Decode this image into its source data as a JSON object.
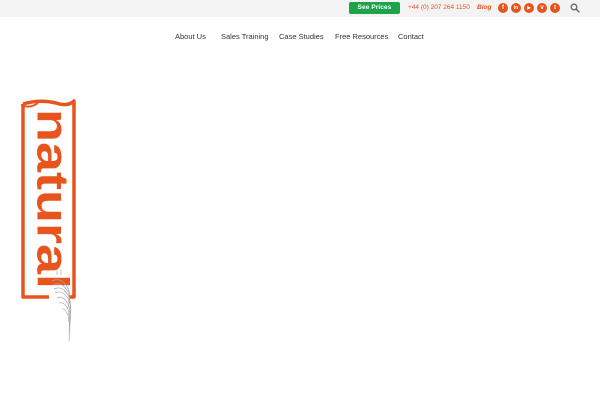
{
  "topbar": {
    "cta_label": "See Prices",
    "phone": "+44 (0) 207 264 1150",
    "blog_label": "Blog",
    "social": [
      {
        "icon": "facebook-icon",
        "glyph": "f"
      },
      {
        "icon": "linkedin-icon",
        "glyph": "in"
      },
      {
        "icon": "youtube-icon",
        "glyph": "▶"
      },
      {
        "icon": "vimeo-icon",
        "glyph": "v"
      },
      {
        "icon": "twitter-icon",
        "glyph": "t"
      }
    ],
    "search_icon": "search-icon"
  },
  "nav": {
    "items": [
      "About Us",
      "Sales Training",
      "Case Studies",
      "Free Resources",
      "Contact"
    ]
  },
  "logo": {
    "word": "natural",
    "icon": "logo"
  },
  "colors": {
    "accent": "#e8541e",
    "cta": "#1ea34a",
    "topbar_bg": "#f3f3f3",
    "nav_text": "#333333"
  }
}
